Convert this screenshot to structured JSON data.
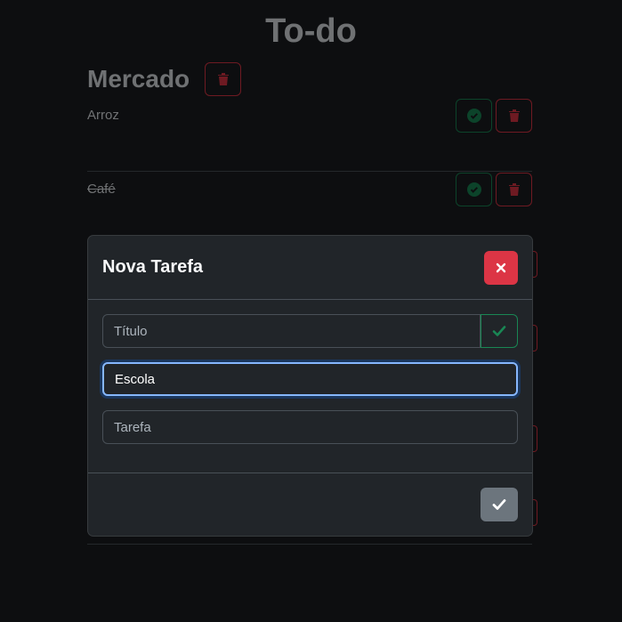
{
  "app": {
    "title": "To-do"
  },
  "list": {
    "title": "Mercado",
    "tasks": [
      {
        "text": "Arroz",
        "done": false
      },
      {
        "text": "Café",
        "done": true
      }
    ]
  },
  "modal": {
    "title": "Nova Tarefa",
    "title_field": {
      "placeholder": "Título",
      "value": ""
    },
    "list_field": {
      "value": "Escola"
    },
    "task_field": {
      "placeholder": "Tarefa",
      "value": ""
    }
  },
  "icons": {
    "trash": "trash-icon",
    "check_circle": "check-circle-icon",
    "close": "close-icon",
    "check": "check-icon"
  },
  "colors": {
    "danger": "#dc3545",
    "success": "#198754",
    "secondary": "#6c757d",
    "focus": "#86b7fe"
  }
}
